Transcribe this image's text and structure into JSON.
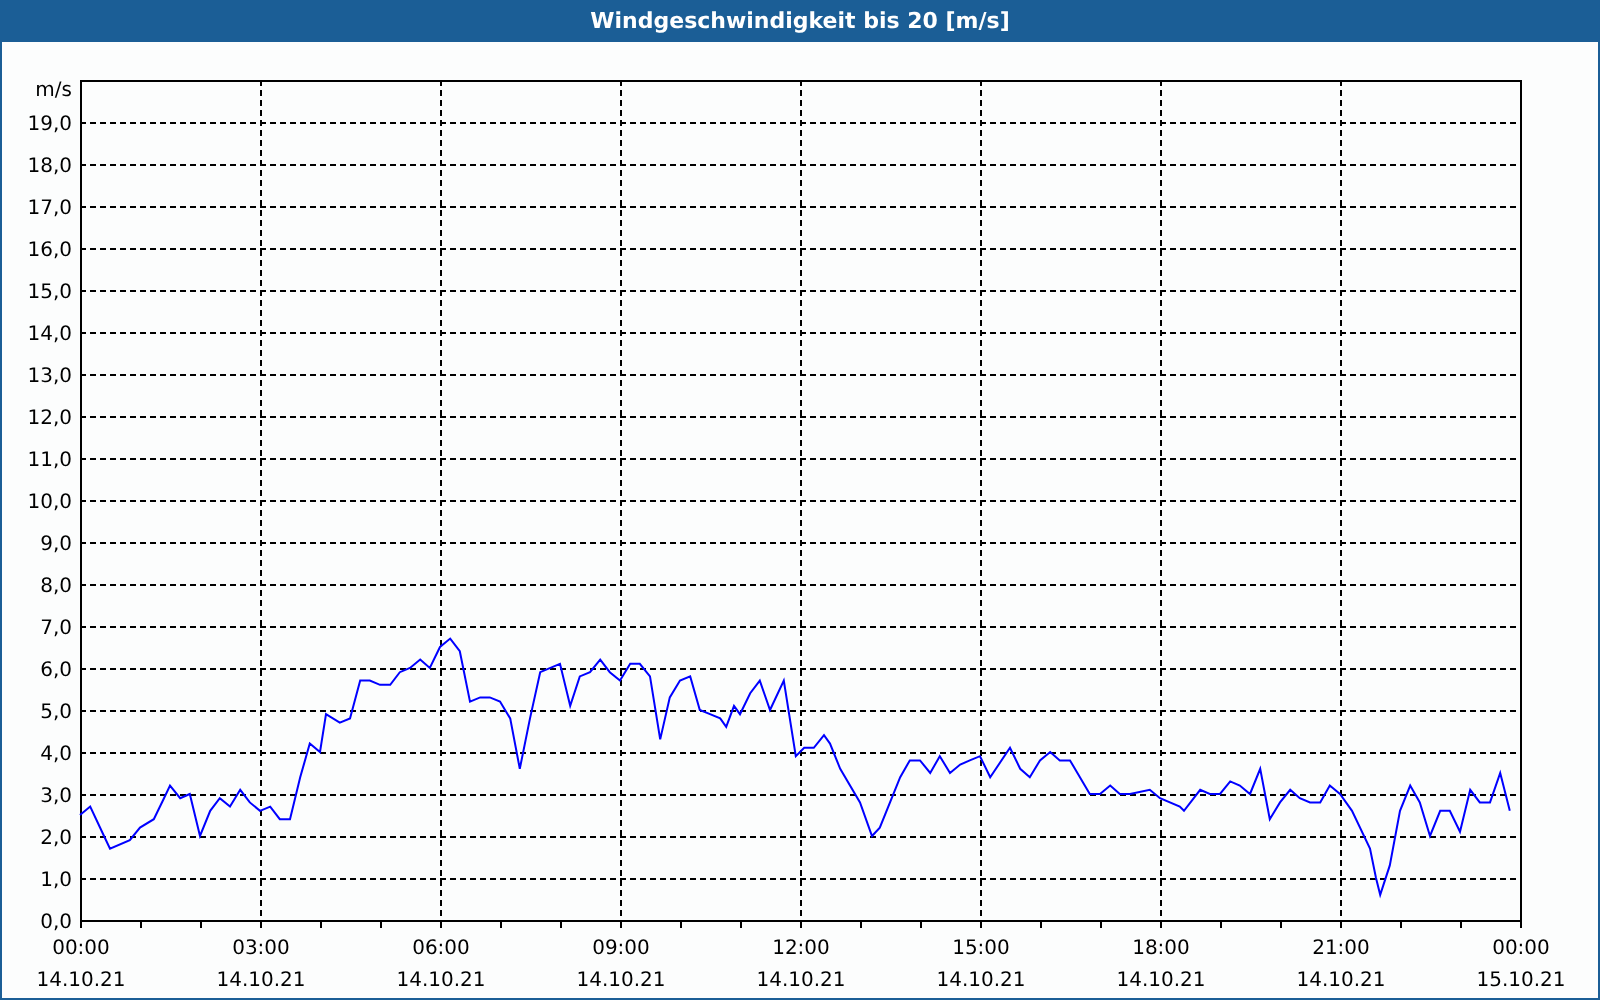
{
  "window": {
    "title": "Windgeschwindigkeit bis 20 [m/s]"
  },
  "chart": {
    "chart_data": {
      "type": "line",
      "ylabel": "m/s",
      "xlim": [
        0,
        24
      ],
      "ylim": [
        0,
        20
      ],
      "x": [
        0,
        0.17,
        0.4,
        0.5,
        0.83,
        1,
        1.23,
        1.4,
        1.5,
        1.67,
        1.83,
        2,
        2.17,
        2.33,
        2.5,
        2.67,
        2.83,
        3,
        3.17,
        3.33,
        3.5,
        3.67,
        3.83,
        4,
        4.1,
        4.33,
        4.5,
        4.67,
        4.83,
        5,
        5.17,
        5.33,
        5.5,
        5.67,
        5.83,
        6,
        6.17,
        6.33,
        6.5,
        6.67,
        6.83,
        7,
        7.17,
        7.33,
        7.5,
        7.67,
        8,
        8.17,
        8.33,
        8.5,
        8.67,
        8.83,
        9,
        9.17,
        9.33,
        9.5,
        9.67,
        9.83,
        10,
        10.17,
        10.33,
        10.5,
        10.67,
        10.77,
        10.9,
        11,
        11.17,
        11.33,
        11.5,
        11.73,
        11.93,
        12.07,
        12.23,
        12.4,
        12.5,
        12.67,
        13,
        13.2,
        13.33,
        13.67,
        13.83,
        14,
        14.17,
        14.33,
        14.5,
        14.67,
        14.83,
        15,
        15.17,
        15.5,
        15.67,
        15.83,
        16,
        16.17,
        16.33,
        16.5,
        16.83,
        17,
        17.17,
        17.33,
        17.5,
        17.83,
        18,
        18.33,
        18.4,
        18.67,
        18.83,
        19,
        19.17,
        19.33,
        19.5,
        19.67,
        19.83,
        20,
        20.17,
        20.33,
        20.5,
        20.67,
        20.83,
        21,
        21.2,
        21.5,
        21.6,
        21.67,
        21.83,
        22,
        22.17,
        22.33,
        22.5,
        22.67,
        22.83,
        23,
        23.17,
        23.33,
        23.5,
        23.67,
        23.83
      ],
      "grid": true,
      "series": [
        {
          "color": "#0000ff",
          "values": [
            2.5,
            2.7,
            2.0,
            1.7,
            1.9,
            2.2,
            2.4,
            2.9,
            3.2,
            2.9,
            3.0,
            2.0,
            2.6,
            2.9,
            2.7,
            3.1,
            2.8,
            2.6,
            2.7,
            2.4,
            2.4,
            3.4,
            4.2,
            4.0,
            4.9,
            4.7,
            4.8,
            5.7,
            5.7,
            5.6,
            5.6,
            5.9,
            6.0,
            6.2,
            6.0,
            6.5,
            6.7,
            6.4,
            5.2,
            5.3,
            5.3,
            5.2,
            4.8,
            3.6,
            4.8,
            5.9,
            6.1,
            5.1,
            5.8,
            5.9,
            6.2,
            5.9,
            5.7,
            6.1,
            6.1,
            5.8,
            4.3,
            5.3,
            5.7,
            5.8,
            5.0,
            4.9,
            4.8,
            4.6,
            5.1,
            4.9,
            5.4,
            5.7,
            5.0,
            5.7,
            3.9,
            4.1,
            4.1,
            4.4,
            4.2,
            3.6,
            2.8,
            2.0,
            2.2,
            3.4,
            3.8,
            3.8,
            3.5,
            3.9,
            3.5,
            3.7,
            3.8,
            3.9,
            3.4,
            4.1,
            3.6,
            3.4,
            3.8,
            4.0,
            3.8,
            3.8,
            3.0,
            3.0,
            3.2,
            3.0,
            3.0,
            3.1,
            2.9,
            2.7,
            2.6,
            3.1,
            3.0,
            3.0,
            3.3,
            3.2,
            3.0,
            3.6,
            2.4,
            2.8,
            3.1,
            2.9,
            2.8,
            2.8,
            3.2,
            3.0,
            2.6,
            1.7,
            1.0,
            0.6,
            1.3,
            2.6,
            3.2,
            2.8,
            2.0,
            2.6,
            2.6,
            2.1,
            3.1,
            2.8,
            2.8,
            3.5,
            2.6
          ]
        }
      ],
      "xticks": [
        {
          "value": 0,
          "label": "00:00"
        },
        {
          "value": 3,
          "label": "03:00"
        },
        {
          "value": 6,
          "label": "06:00"
        },
        {
          "value": 9,
          "label": "09:00"
        },
        {
          "value": 12,
          "label": "12:00"
        },
        {
          "value": 15,
          "label": "15:00"
        },
        {
          "value": 18,
          "label": "18:00"
        },
        {
          "value": 21,
          "label": "21:00"
        },
        {
          "value": 24,
          "label": "00:00"
        }
      ],
      "annotations": [
        "14.10.21",
        "14.10.21",
        "14.10.21",
        "14.10.21",
        "14.10.21",
        "14.10.21",
        "14.10.21",
        "14.10.21",
        "15.10.21"
      ],
      "yticks": [
        {
          "value": 0,
          "label": "0,0"
        },
        {
          "value": 1,
          "label": "1,0"
        },
        {
          "value": 2,
          "label": "2,0"
        },
        {
          "value": 3,
          "label": "3,0"
        },
        {
          "value": 4,
          "label": "4,0"
        },
        {
          "value": 5,
          "label": "5,0"
        },
        {
          "value": 6,
          "label": "6,0"
        },
        {
          "value": 7,
          "label": "7,0"
        },
        {
          "value": 8,
          "label": "8,0"
        },
        {
          "value": 9,
          "label": "9,0"
        },
        {
          "value": 10,
          "label": "10,0"
        },
        {
          "value": 11,
          "label": "11,0"
        },
        {
          "value": 12,
          "label": "12,0"
        },
        {
          "value": 13,
          "label": "13,0"
        },
        {
          "value": 14,
          "label": "14,0"
        },
        {
          "value": 15,
          "label": "15,0"
        },
        {
          "value": 16,
          "label": "16,0"
        },
        {
          "value": 17,
          "label": "17,0"
        },
        {
          "value": 18,
          "label": "18,0"
        },
        {
          "value": 19,
          "label": "19,0"
        }
      ]
    }
  }
}
